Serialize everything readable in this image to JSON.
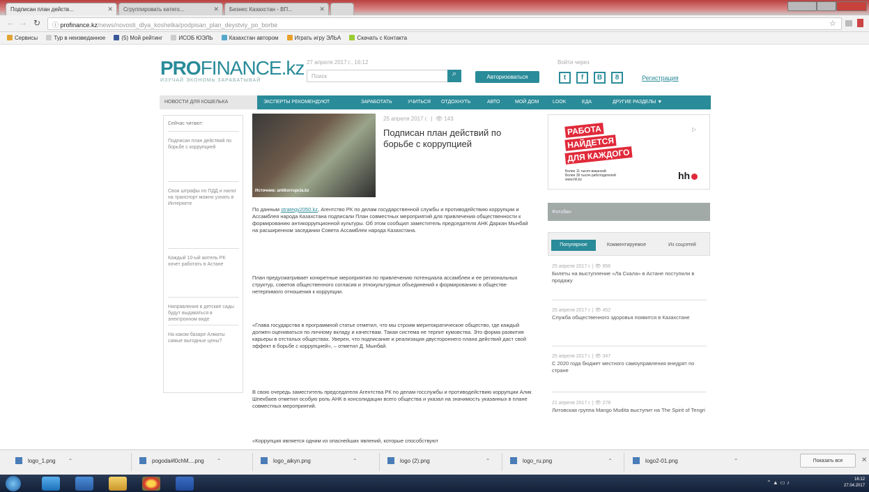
{
  "browser": {
    "tabs": [
      "Подписан план действ...",
      "Сгруппировать катего...",
      "Бизнес Казахстан - ВП..."
    ],
    "url_host": "profinance.kz",
    "url_path": "/news/novosti_dlya_koshelka/podpisan_plan_deystviy_po_borbe",
    "bookmarks": [
      "Сервисы",
      "Тур в неизведанное",
      "(5) Мой рейтинг",
      "ИСОБ ЮЭЛЬ",
      "Казахстан автором",
      "Играть игру ЭЛЬА",
      "Скачать с Контакта"
    ]
  },
  "header": {
    "logo_bold": "PRO",
    "logo_rest": "FINANCE.kz",
    "tagline": "ИЗУЧАЙ  ЭКОНОМЬ  ЗАРАБАТЫВАЙ",
    "datetime": "27 апреля 2017 г., 16:12",
    "search_placeholder": "Поиск",
    "search_icon": "search-icon",
    "auth_button": "Авторизоваться",
    "login_via": "Войти через",
    "social": [
      "t",
      "f",
      "B",
      "8"
    ],
    "register": "Регистрация"
  },
  "nav": [
    "НОВОСТИ ДЛЯ КОШЕЛЬКА",
    "ЭКСПЕРТЫ РЕКОМЕНДУЮТ",
    "ЗАРАБОТАТЬ",
    "УЧИТЬСЯ",
    "ОТДОХНУТЬ",
    "АВТО",
    "МОЙ ДОМ",
    "LOOK",
    "ЕДА",
    "ДРУГИЕ РАЗДЕЛЫ ▼"
  ],
  "left": {
    "label": "Сейчас читают:",
    "items": [
      "Подписан план действий по борьбе с коррупцией",
      "Свои штрафы по ПДД и налог на транспорт можно узнать в Интернете",
      "Каждый 10-ый житель РК хочет работать в Астане",
      "Направления в детские сады будут выдаваться в электронном виде",
      "На каком базаре Алматы самые выгодные цены?"
    ]
  },
  "article": {
    "photo_caption": "Источник: antikorrupcia.kz",
    "date": "25 апреля 2017 г.",
    "views": "143",
    "title": "Подписан план действий по борьбе с коррупцией",
    "p1_link": "strategy2050.kz",
    "p1_pre": "По данным ",
    "p1_post": ", Агентство РК по делам государственной службы и противодействию коррупции и Ассамблея народа Казахстана подписали План совместных мероприятий для привлечения общественности к формированию антикоррупционной культуры. Об этом сообщил заместитель председателя АНК Даркан Мынбай на расширенном заседании Совета Ассамблеи народа Казахстана.",
    "p2": "План предусматривает конкретные мероприятия по привлечению потенциала ассамблеи и ее региональных структур, советов общественного согласия и этнокультурных объединений к формированию в обществе нетерпимого отношения к коррупции.",
    "p3": "«Глава государства в программной статье отметил, что мы строим меритократическое общество, где каждый должен оцениваться по личному вкладу и качествам. Такая система не терпит кумовства. Это форма развития карьеры в отсталых обществах. Уверен, что подписание и реализация двустороннего плана действий даст свой эффект в борьбе с коррупцией», – отметил Д. Мынбай.",
    "p4": "В свою очередь заместитель председателя Агентства РК по делам госслужбы и противодействию коррупции Алик Шпекбаев отметил особую роль АНК в консолидации всего общества и указал на значимость указанных в плане совместных мероприятий.",
    "p5": "«Коррупция является одним из опаснейших явлений, которые способствуют"
  },
  "right": {
    "ad_line1": "РАБОТА",
    "ad_line2": "НАЙДЕТСЯ",
    "ad_line3": "ДЛЯ КАЖДОГО",
    "ad_small": "Более 11 тысяч вакансий\nБолее 30 тысяч работодателей\nwww.hh.kz",
    "ad_brand": "hh",
    "photobar": "Фотобан",
    "tabs": [
      "Популярное",
      "Комментируемое",
      "Из соцсетей"
    ],
    "items": [
      {
        "date": "25 апреля 2017 г.",
        "views": "956",
        "title": "Билеты на выступление «Ла Скала» в Астане поступили в продажу"
      },
      {
        "date": "25 апреля 2017 г.",
        "views": "452",
        "title": "Служба общественного здоровья появится в Казахстане"
      },
      {
        "date": "25 апреля 2017 г.",
        "views": "347",
        "title": "С 2020 года бюджет местного самоуправления внедрят по стране"
      },
      {
        "date": "21 апреля 2017 г.",
        "views": "278",
        "title": "Литовская группа Mango Mudita выступит на The Spirit of Tengri"
      }
    ]
  },
  "downloads": {
    "files": [
      "logo_1.png",
      "pogoda#l0chM....png",
      "logo_aikyn.png",
      "logo (2).png",
      "logo_ru.png",
      "logo2-01.png"
    ],
    "show_all": "Показать все"
  },
  "taskbar": {
    "time": "16:12",
    "date": "27.04.2017"
  }
}
